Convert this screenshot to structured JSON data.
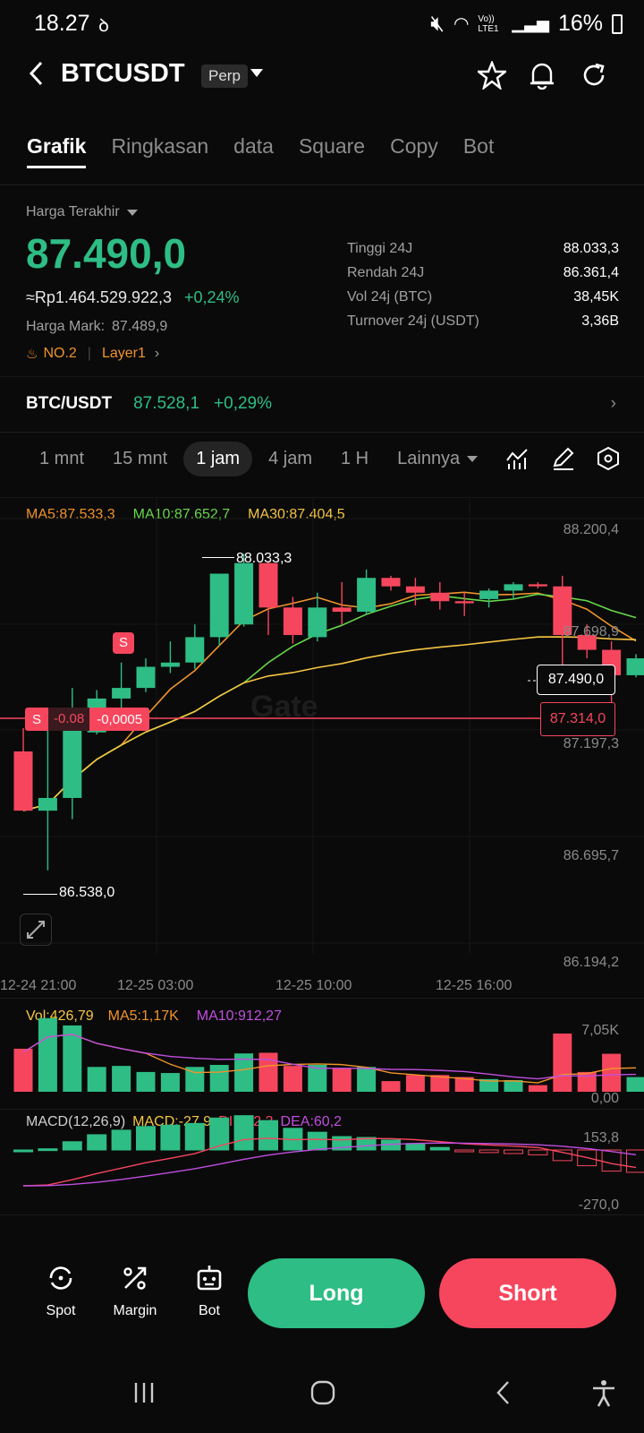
{
  "status": {
    "time": "18.27",
    "battery": "16%",
    "lte": "Vo)) LTE1"
  },
  "header": {
    "title": "BTCUSDT",
    "badge": "Perp"
  },
  "tabs": [
    "Grafik",
    "Ringkasan",
    "data",
    "Square",
    "Copy",
    "Bot"
  ],
  "price": {
    "label": "Harga Terakhir",
    "last": "87.490,0",
    "idr": "≈Rp1.464.529.922,3",
    "change": "+0,24%",
    "mark_label": "Harga Mark:",
    "mark_value": "87.489,9",
    "rank": "NO.2",
    "tag": "Layer1"
  },
  "stats": [
    {
      "label": "Tinggi 24J",
      "value": "88.033,3"
    },
    {
      "label": "Rendah 24J",
      "value": "86.361,4"
    },
    {
      "label": "Vol 24j (BTC)",
      "value": "38,45K"
    },
    {
      "label": "Turnover 24j (USDT)",
      "value": "3,36B"
    }
  ],
  "spot": {
    "pair": "BTC/USDT",
    "price": "87.528,1",
    "change": "+0,29%"
  },
  "timeframes": [
    "1 mnt",
    "15 mnt",
    "1 jam",
    "4 jam",
    "1 H",
    "Lainnya"
  ],
  "active_timeframe": "1 jam",
  "ma_legend": {
    "ma5": "MA5:87.533,3",
    "ma10": "MA10:87.652,7",
    "ma30": "MA30:87.404,5"
  },
  "chart": {
    "y_ticks": [
      "88.200,4",
      "87.698,9",
      "87.197,3",
      "86.695,7",
      "86.194,2"
    ],
    "x_ticks": [
      "12-24 21:00",
      "12-25 03:00",
      "12-25 10:00",
      "12-25 16:00"
    ],
    "high_label": "88.033,3",
    "low_label": "86.538,0",
    "current_price_tag": "87.490,0",
    "position_price_tag": "87.314,0",
    "position_side": "S",
    "position_pnl": "-0.08",
    "position_pnl_pct": "-0,0005",
    "sell_marker": "S",
    "watermark": "Gate"
  },
  "chart_data": {
    "type": "candlestick",
    "ylim": [
      86194.2,
      88200.4
    ],
    "candles": [
      {
        "o": 87100,
        "h": 87210,
        "c": 86820,
        "l": 86820
      },
      {
        "o": 86820,
        "h": 87230,
        "c": 86880,
        "l": 86538
      },
      {
        "o": 86880,
        "h": 87400,
        "c": 87200,
        "l": 86780
      },
      {
        "o": 87190,
        "h": 87390,
        "c": 87350,
        "l": 87180
      },
      {
        "o": 87350,
        "h": 87520,
        "c": 87400,
        "l": 87300
      },
      {
        "o": 87400,
        "h": 87540,
        "c": 87500,
        "l": 87380
      },
      {
        "o": 87500,
        "h": 87620,
        "c": 87520,
        "l": 87470
      },
      {
        "o": 87520,
        "h": 87700,
        "c": 87640,
        "l": 87490
      },
      {
        "o": 87640,
        "h": 87830,
        "c": 87940,
        "l": 87600
      },
      {
        "o": 87700,
        "h": 88033.3,
        "c": 87990,
        "l": 87690
      },
      {
        "o": 87990,
        "h": 88000,
        "c": 87780,
        "l": 87650
      },
      {
        "o": 87780,
        "h": 87830,
        "c": 87650,
        "l": 87610
      },
      {
        "o": 87640,
        "h": 87850,
        "c": 87780,
        "l": 87620
      },
      {
        "o": 87780,
        "h": 87900,
        "c": 87760,
        "l": 87700
      },
      {
        "o": 87760,
        "h": 87960,
        "c": 87920,
        "l": 87750
      },
      {
        "o": 87920,
        "h": 87930,
        "c": 87880,
        "l": 87860
      },
      {
        "o": 87880,
        "h": 87920,
        "c": 87850,
        "l": 87790
      },
      {
        "o": 87850,
        "h": 87900,
        "c": 87810,
        "l": 87770
      },
      {
        "o": 87810,
        "h": 87850,
        "c": 87800,
        "l": 87740
      },
      {
        "o": 87820,
        "h": 87870,
        "c": 87860,
        "l": 87780
      },
      {
        "o": 87860,
        "h": 87900,
        "c": 87890,
        "l": 87820
      },
      {
        "o": 87890,
        "h": 87900,
        "c": 87880,
        "l": 87870
      },
      {
        "o": 87880,
        "h": 87930,
        "c": 87650,
        "l": 87390
      },
      {
        "o": 87650,
        "h": 87700,
        "c": 87580,
        "l": 87540
      },
      {
        "o": 87580,
        "h": 87620,
        "c": 87460,
        "l": 87280
      },
      {
        "o": 87460,
        "h": 87560,
        "c": 87540,
        "l": 87450
      }
    ],
    "ma_series": [
      {
        "name": "MA5",
        "color": "#f0932b"
      },
      {
        "name": "MA10",
        "color": "#67d84a"
      },
      {
        "name": "MA30",
        "color": "#f5c542"
      }
    ]
  },
  "volume": {
    "legend_vol": "Vol:426,79",
    "legend_ma5": "MA5:1,17K",
    "legend_ma10": "MA10:912,27",
    "y_top": "7,05K",
    "y_bottom": "0,00"
  },
  "macd": {
    "legend_title": "MACD(12,26,9)",
    "legend_macd": "MACD:-27,9",
    "legend_dif": "DIF:32,3",
    "legend_dea": "DEA:60,2",
    "y_top": "153,8",
    "y_bottom": "-270,0"
  },
  "bottom": {
    "spot": "Spot",
    "margin": "Margin",
    "bot": "Bot",
    "long": "Long",
    "short": "Short"
  },
  "colors": {
    "up": "#2ebd85",
    "down": "#f6465d",
    "bg": "#0a0a0a"
  }
}
